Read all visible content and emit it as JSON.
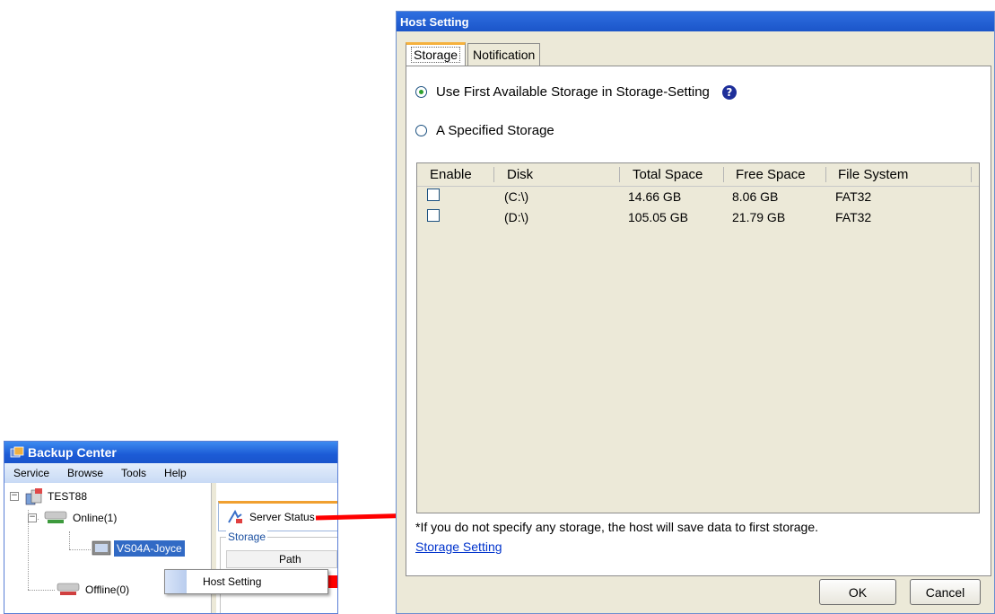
{
  "backup_center": {
    "title": "Backup Center",
    "menu": [
      "Service",
      "Browse",
      "Tools",
      "Help"
    ],
    "tree": {
      "root": "TEST88",
      "online": "Online(1)",
      "host": "VS04A-Joyce",
      "offline": "Offline(0)"
    },
    "server_tab": "Server Status",
    "storage_group": "Storage",
    "path_header": "Path"
  },
  "context_menu": {
    "item": "Host Setting"
  },
  "dialog": {
    "title": "Host Setting",
    "tabs": [
      "Storage",
      "Notification"
    ],
    "option_first": "Use First Available Storage in Storage-Setting",
    "option_specified": "A Specified Storage",
    "selected_option": "first",
    "help_glyph": "?",
    "columns": [
      "Enable",
      "Disk",
      "Total Space",
      "Free Space",
      "File System"
    ],
    "rows": [
      {
        "enabled": false,
        "disk": "(C:\\)",
        "total": "14.66 GB",
        "free": "8.06 GB",
        "fs": "FAT32"
      },
      {
        "enabled": false,
        "disk": "(D:\\)",
        "total": "105.05 GB",
        "free": "21.79 GB",
        "fs": "FAT32"
      }
    ],
    "note": "*If you do not specify any storage, the host will save data to first storage.",
    "link": "Storage Setting",
    "ok": "OK",
    "cancel": "Cancel"
  },
  "colors": {
    "title_bar": "#1b55c9",
    "accent_tab": "#f5b13e",
    "selection": "#316ac5",
    "arrow": "#ff0000"
  }
}
